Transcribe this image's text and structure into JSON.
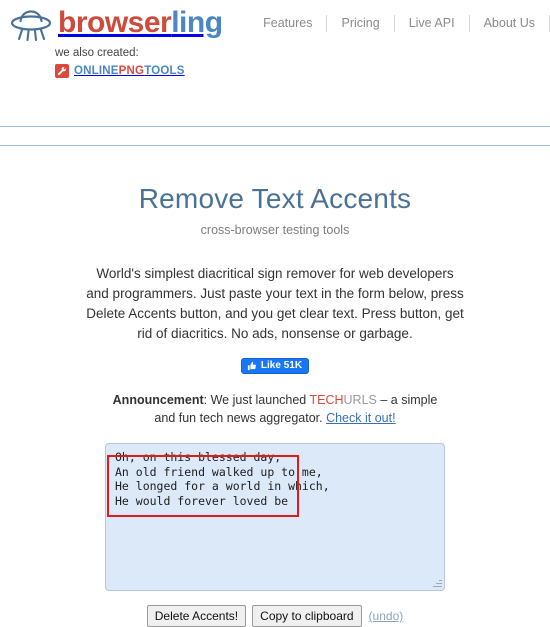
{
  "header": {
    "logo": {
      "icon": "ufo-icon",
      "brand_first": "browser",
      "brand_second": "ling",
      "brand_first_color": "#cc4b3c",
      "brand_second_color": "#4a87c4"
    },
    "also_created_label": "we also created:",
    "partner": {
      "icon": "wrench-icon",
      "part1": "ONLINE",
      "part2": "PNG",
      "part3": "TOOLS",
      "badge_color": "#d94a3d"
    },
    "nav": [
      {
        "label": "Features"
      },
      {
        "label": "Pricing"
      },
      {
        "label": "Live API"
      },
      {
        "label": "About Us"
      }
    ]
  },
  "main": {
    "title": "Remove Text Accents",
    "subtitle": "cross-browser testing tools",
    "description": "World's simplest diacritical sign remover for web developers and programmers. Just paste your text in the form below, press Delete Accents button, and you get clear text. Press button, get rid of diacritics. No ads, nonsense or garbage.",
    "facebook": {
      "icon": "thumbs-up-icon",
      "label": "Like 51K",
      "color": "#1877f2"
    },
    "announcement": {
      "label": "Announcement",
      "text_before": ": We just launched ",
      "brand_part1": "TECH",
      "brand_part2": "URLS",
      "text_after": " – a simple and fun tech news aggregator. ",
      "link": "Check it out!",
      "brand_part1_color": "#d94a3d",
      "brand_part2_color": "#9a9a9a",
      "link_color": "#3b6fb5"
    },
    "editor": {
      "value": "Oh, on this blessed day,\nAn old friend walked up to me,\nHe longed for a world in which,\nHe would forever loved be",
      "placeholder": "",
      "background_color": "#dbe9f8",
      "annotation_color": "#e01b1b"
    },
    "actions": {
      "primary_label": "Delete Accents!",
      "copy_label": "Copy to clipboard",
      "undo_label": "(undo)"
    }
  }
}
